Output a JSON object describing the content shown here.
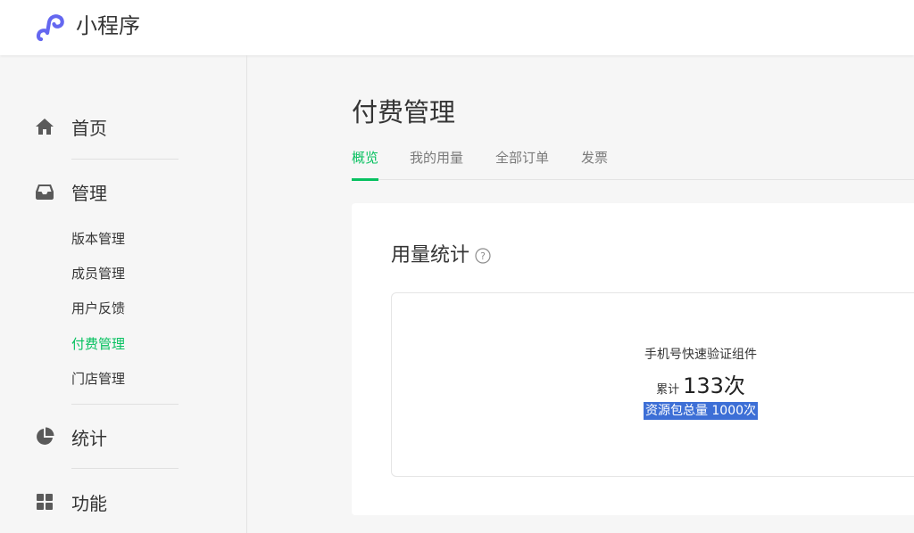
{
  "header": {
    "app_title": "小程序",
    "logo_color": "#6467f0"
  },
  "sidebar": {
    "main_items": [
      {
        "label": "首页",
        "icon": "home-icon"
      },
      {
        "label": "管理",
        "icon": "inbox-icon"
      },
      {
        "label": "统计",
        "icon": "pie-chart-icon"
      },
      {
        "label": "功能",
        "icon": "grid-icon"
      }
    ],
    "sub_items": [
      {
        "label": "版本管理",
        "active": false
      },
      {
        "label": "成员管理",
        "active": false
      },
      {
        "label": "用户反馈",
        "active": false
      },
      {
        "label": "付费管理",
        "active": true
      },
      {
        "label": "门店管理",
        "active": false
      }
    ]
  },
  "main": {
    "page_title": "付费管理",
    "tabs": [
      {
        "label": "概览",
        "active": true
      },
      {
        "label": "我的用量",
        "active": false
      },
      {
        "label": "全部订单",
        "active": false
      },
      {
        "label": "发票",
        "active": false
      }
    ],
    "section_title": "用量统计",
    "stat": {
      "name": "手机号快速验证组件",
      "prefix": "累计",
      "value": "133次",
      "total": "资源包总量 1000次"
    }
  },
  "colors": {
    "accent": "#07c160",
    "highlight": "#3d6fd6"
  }
}
